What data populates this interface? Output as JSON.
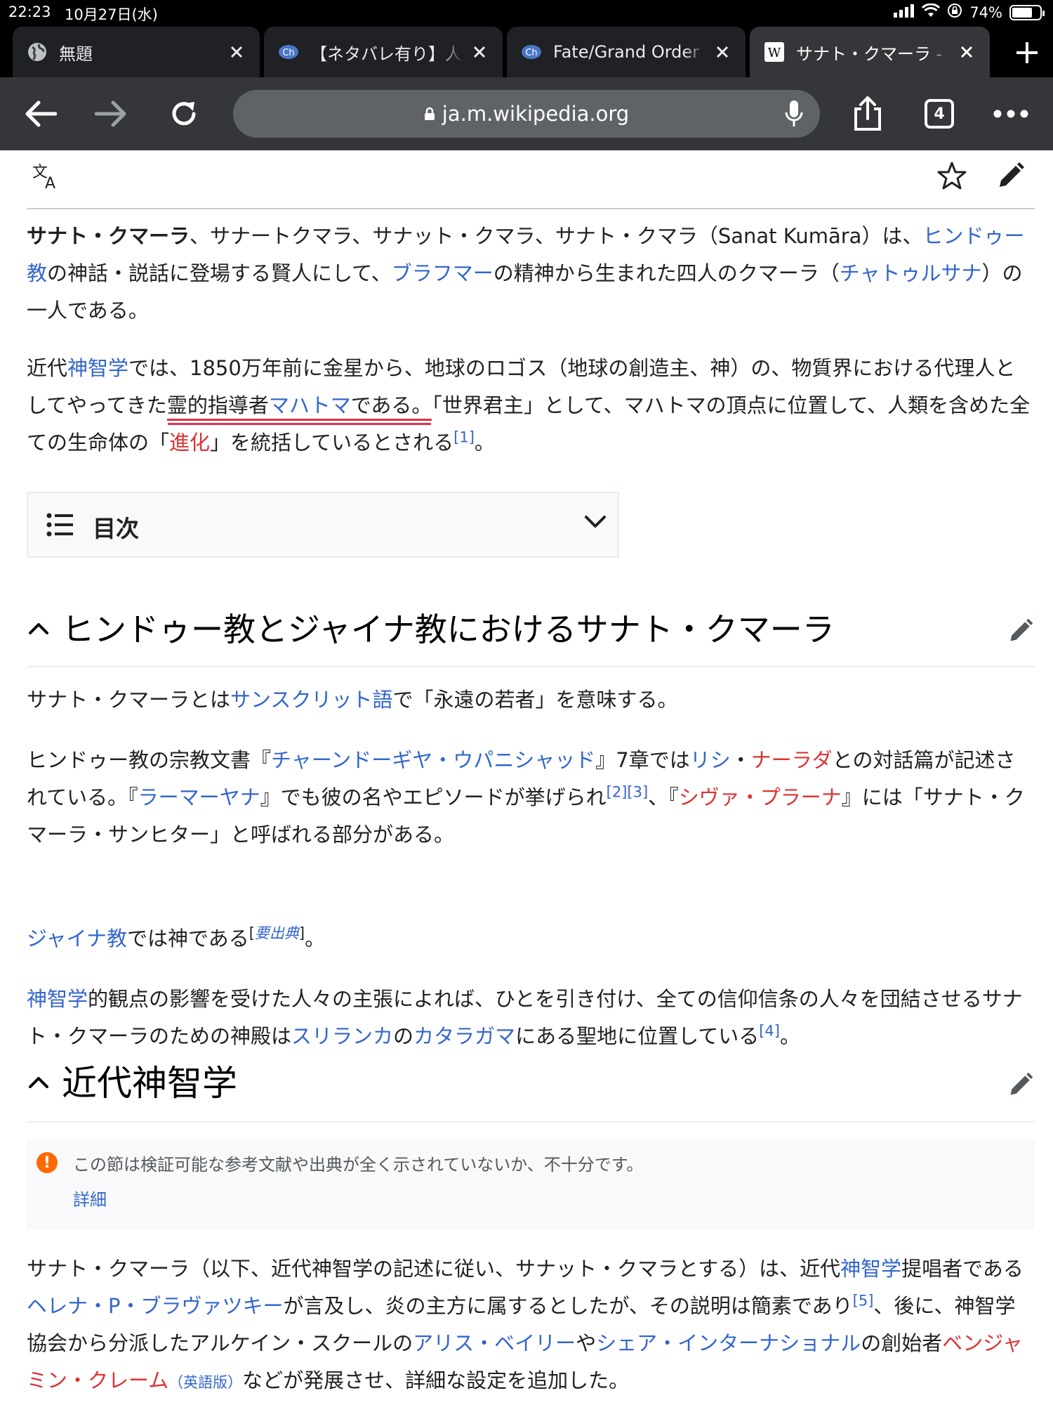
{
  "status": {
    "time": "22:23",
    "date": "10月27日(水)",
    "battery": "74%",
    "battery_level": 0.74
  },
  "tabs": [
    {
      "title": "無題",
      "icon": "globe-icon"
    },
    {
      "title": "【ネタバレ有り】人",
      "icon": "ch-icon",
      "icon_text": "Ch"
    },
    {
      "title": "Fate/Grand Order",
      "icon": "ch-icon",
      "icon_text": "Ch"
    },
    {
      "title": "サナト・クマーラ -",
      "icon": "wikipedia-icon",
      "icon_text": "W",
      "active": true
    }
  ],
  "toolbar": {
    "url": "ja.m.wikipedia.org",
    "tab_count": "4"
  },
  "article": {
    "intro1": {
      "bold": "サナト・クマーラ",
      "t1": "、サナートクマラ、サナット・クマラ、サナト・クマラ（Sanat Kumāra）は、",
      "l1": "ヒンドゥー教",
      "t2": "の神話・説話に登場する賢人にして、",
      "l2": "ブラフマー",
      "t3": "の精神から生まれた四人のクマーラ（",
      "l3": "チャトゥルサナ",
      "t4": "）の一人である。"
    },
    "intro2": {
      "t1": "近代",
      "l1": "神智学",
      "t2": "では、1850万年前に金星から、地球のロゴス（地球の創造主、神）の、物質界における代理人としてやってきた",
      "u1": "霊的指導者",
      "ul1": "マハトマ",
      "u2": "である。",
      "t3": "「世界君主」として、マハトマの頂点に位置して、人類を含めた全ての生命体の「",
      "r1": "進化",
      "t4": "」を統括しているとされる",
      "ref1": "[1]",
      "t5": "。"
    },
    "toc_label": "目次",
    "section1": {
      "heading": "ヒンドゥー教とジャイナ教におけるサナト・クマーラ",
      "p1": {
        "t1": "サナト・クマーラとは",
        "l1": "サンスクリット語",
        "t2": "で「永遠の若者」を意味する。"
      },
      "p2": {
        "t1": "ヒンドゥー教の宗教文書『",
        "l1": "チャーンドーギヤ・ウパニシャッド",
        "t2": "』7章では",
        "l2": "リシ",
        "t3": "・",
        "r1": "ナーラダ",
        "t4": "との対話篇が記述されている。『",
        "l3": "ラーマーヤナ",
        "t5": "』でも彼の名やエピソードが挙げられ",
        "ref2": "[2]",
        "ref3": "[3]",
        "t6": "、『",
        "r2": "シヴァ・プラーナ",
        "t7": "』には「サナト・クマーラ・サンヒター」と呼ばれる部分がある。"
      },
      "p3": {
        "l1": "ジャイナ教",
        "t1": "では神である",
        "cn_open": "[",
        "cn": "要出典",
        "cn_close": "]",
        "t2": "。"
      },
      "p4": {
        "l1": "神智学",
        "t1": "的観点の影響を受けた人々の主張によれば、ひとを引き付け、全ての信仰信条の人々を団結させるサナト・クマーラのための神殿は",
        "l2": "スリランカ",
        "t2": "の",
        "l3": "カタラガマ",
        "t3": "にある聖地に位置している",
        "ref4": "[4]",
        "t4": "。"
      }
    },
    "section2": {
      "heading": "近代神智学",
      "notice": "この節は検証可能な参考文献や出典が全く示されていないか、不十分です。",
      "notice_more": "詳細",
      "p1": {
        "t1": "サナト・クマーラ（以下、近代神智学の記述に従い、サナット・クマラとする）は、近代",
        "l1": "神智学",
        "t2": "提唱者である",
        "l2": "ヘレナ・P・ブラヴァツキー",
        "t3": "が言及し、炎の主方に属するとしたが、その説明は簡素であり",
        "ref5": "[5]",
        "t4": "、後に、神智学協会から分派したアルケイン・スクールの",
        "l3": "アリス・ベイリー",
        "t5": "や",
        "l4": "シェア・インターナショナル",
        "t6": "の創始者",
        "r1": "ベンジャミン・クレーム",
        "en": "（英語版）",
        "t7": "などが発展させ、詳細な設定を追加した。"
      }
    }
  },
  "colors": {
    "link": "#3366cc",
    "redlink": "#dd3333",
    "chrome_dark": "#35363a",
    "underline": "#e0314b"
  }
}
